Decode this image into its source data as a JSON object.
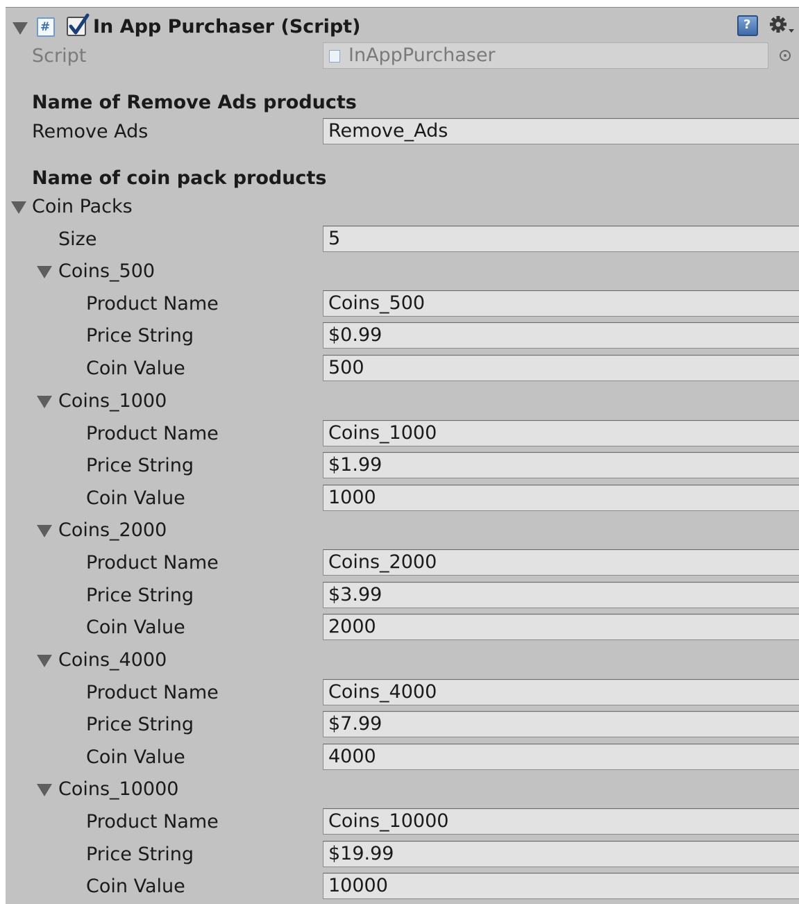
{
  "component": {
    "title": "In App Purchaser (Script)",
    "enabled": true,
    "icons": {
      "component": "csharp-script-icon",
      "help": "help-book-icon",
      "settings": "gear-icon"
    }
  },
  "script_row": {
    "label": "Script",
    "value": "InAppPurchaser"
  },
  "remove_ads": {
    "header": "Name of Remove Ads products",
    "label": "Remove Ads",
    "value": "Remove_Ads"
  },
  "coin_packs": {
    "header": "Name of coin pack products",
    "label": "Coin Packs",
    "size_label": "Size",
    "size": "5",
    "items": [
      {
        "name": "Coins_500",
        "product_name_label": "Product Name",
        "product_name": "Coins_500",
        "price_label": "Price String",
        "price": "$0.99",
        "coin_value_label": "Coin Value",
        "coin_value": "500"
      },
      {
        "name": "Coins_1000",
        "product_name_label": "Product Name",
        "product_name": "Coins_1000",
        "price_label": "Price String",
        "price": "$1.99",
        "coin_value_label": "Coin Value",
        "coin_value": "1000"
      },
      {
        "name": "Coins_2000",
        "product_name_label": "Product Name",
        "product_name": "Coins_2000",
        "price_label": "Price String",
        "price": "$3.99",
        "coin_value_label": "Coin Value",
        "coin_value": "2000"
      },
      {
        "name": "Coins_4000",
        "product_name_label": "Product Name",
        "product_name": "Coins_4000",
        "price_label": "Price String",
        "price": "$7.99",
        "coin_value_label": "Coin Value",
        "coin_value": "4000"
      },
      {
        "name": "Coins_10000",
        "product_name_label": "Product Name",
        "product_name": "Coins_10000",
        "price_label": "Price String",
        "price": "$19.99",
        "coin_value_label": "Coin Value",
        "coin_value": "10000"
      }
    ]
  }
}
